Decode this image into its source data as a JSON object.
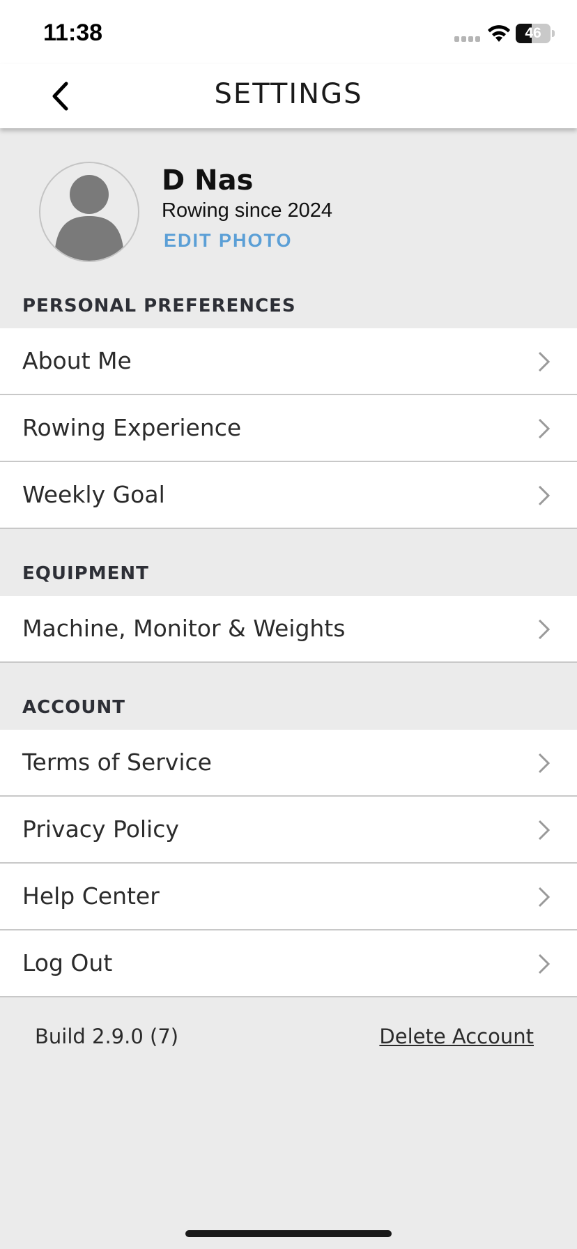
{
  "status_bar": {
    "time": "11:38",
    "battery_level": "46",
    "icons": [
      "signal-icon",
      "wifi-icon",
      "battery-icon"
    ]
  },
  "nav": {
    "title": "SETTINGS",
    "back_icon": "chevron-left-icon"
  },
  "profile": {
    "name": "D Nas",
    "subtitle": "Rowing since 2024",
    "edit_photo": "EDIT PHOTO",
    "avatar_icon": "person-silhouette-icon"
  },
  "sections": {
    "personal": {
      "header": "PERSONAL PREFERENCES",
      "items": [
        {
          "label": "About Me"
        },
        {
          "label": "Rowing Experience"
        },
        {
          "label": "Weekly Goal"
        }
      ]
    },
    "equipment": {
      "header": "EQUIPMENT",
      "items": [
        {
          "label": "Machine, Monitor & Weights"
        }
      ]
    },
    "account": {
      "header": "ACCOUNT",
      "items": [
        {
          "label": "Terms of Service"
        },
        {
          "label": "Privacy Policy"
        },
        {
          "label": "Help Center"
        },
        {
          "label": "Log Out"
        }
      ]
    }
  },
  "footer": {
    "build": "Build 2.9.0 (7)",
    "delete_account": "Delete Account"
  },
  "colors": {
    "background": "#ebebeb",
    "row_background": "#ffffff",
    "accent": "#5b9fd6",
    "separator": "#c8c8c8",
    "chevron": "#9a9a9a"
  }
}
